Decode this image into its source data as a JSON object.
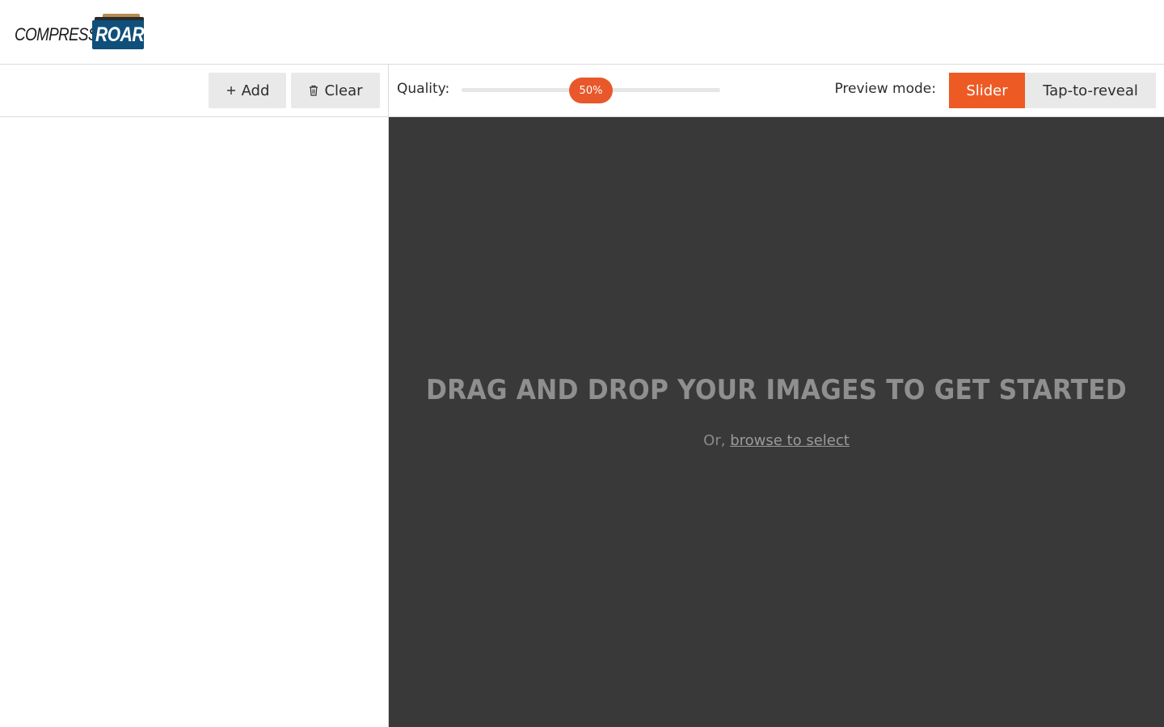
{
  "logo": {
    "text_left": "COMPRESS",
    "text_right": "ROAR"
  },
  "left_toolbar": {
    "add_label": "Add",
    "clear_label": "Clear",
    "add_icon": "plus-icon",
    "clear_icon": "trash-icon"
  },
  "controls": {
    "quality_label": "Quality:",
    "quality_value_text": "50%",
    "quality_value": 50,
    "preview_mode_label": "Preview mode:",
    "preview_modes": [
      "Slider",
      "Tap-to-reveal"
    ],
    "selected_preview_mode": "Slider"
  },
  "dropzone": {
    "title": "DRAG AND DROP YOUR IMAGES TO GET STARTED",
    "sub_prefix": "Or,",
    "browse_link": "browse to select"
  },
  "colors": {
    "accent": "#ee5a24",
    "dropzone_bg": "#393939",
    "logo_blue": "#0f4f7a"
  }
}
